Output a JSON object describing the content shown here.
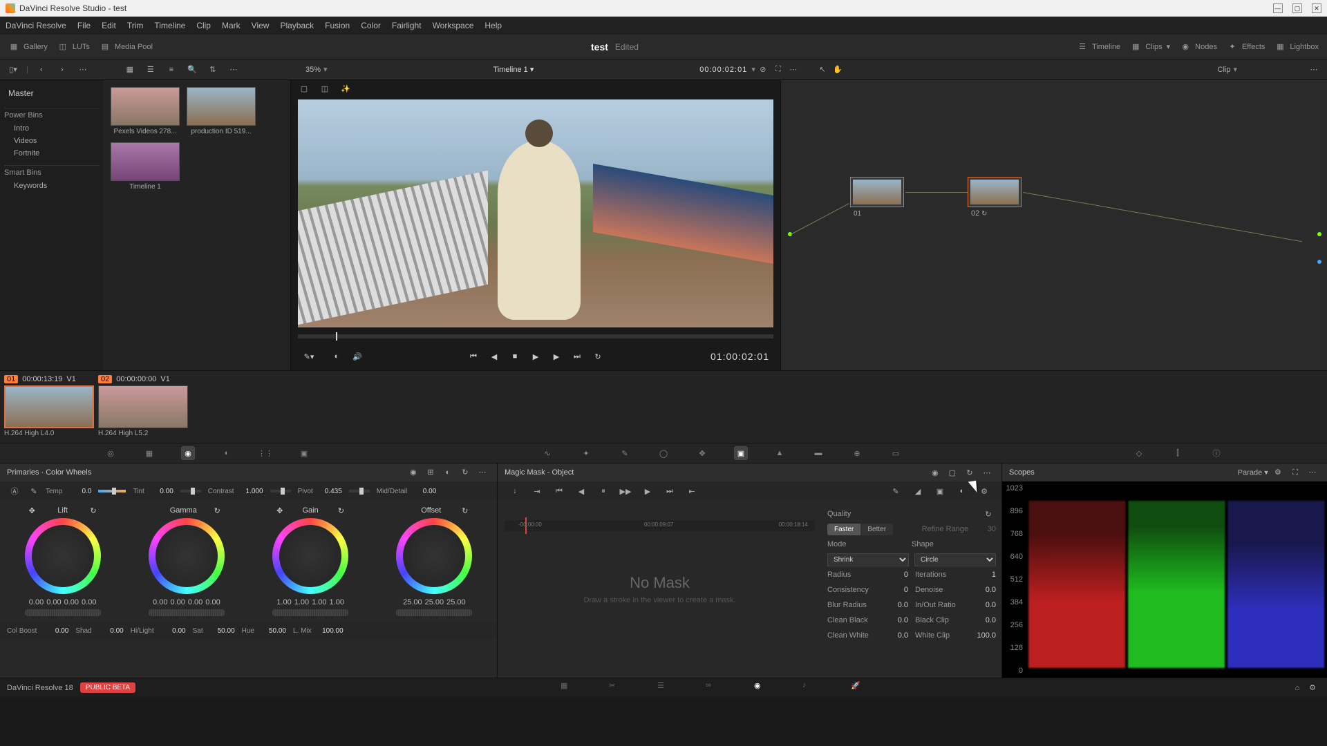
{
  "title": "DaVinci Resolve Studio - test",
  "menu": [
    "DaVinci Resolve",
    "File",
    "Edit",
    "Trim",
    "Timeline",
    "Clip",
    "Mark",
    "View",
    "Playback",
    "Fusion",
    "Color",
    "Fairlight",
    "Workspace",
    "Help"
  ],
  "toolbar": {
    "gallery": "Gallery",
    "luts": "LUTs",
    "mediapool": "Media Pool",
    "project": "test",
    "edited": "Edited",
    "timeline": "Timeline",
    "clips": "Clips",
    "nodes": "Nodes",
    "effects": "Effects",
    "lightbox": "Lightbox"
  },
  "subhdr": {
    "zoom": "35%",
    "timeline_name": "Timeline 1",
    "timecode": "00:00:02:01",
    "clip": "Clip"
  },
  "bins": {
    "master": "Master",
    "powerbins_label": "Power Bins",
    "powerbins": [
      "Intro",
      "Videos",
      "Fortnite"
    ],
    "smartbins_label": "Smart Bins",
    "smartbins": [
      "Keywords"
    ]
  },
  "clips": [
    {
      "name": "Pexels Videos 278..."
    },
    {
      "name": "production ID 519..."
    },
    {
      "name": "Timeline 1"
    }
  ],
  "viewer_tc": "01:00:02:01",
  "nodes": [
    {
      "label": "01"
    },
    {
      "label": "02"
    }
  ],
  "tlclips": [
    {
      "idx": "01",
      "tc": "00:00:13:19",
      "track": "V1",
      "codec": "H.264 High L4.0"
    },
    {
      "idx": "02",
      "tc": "00:00:00:00",
      "track": "V1",
      "codec": "H.264 High L5.2"
    }
  ],
  "primaries": {
    "title": "Primaries · Color Wheels",
    "adjustments": {
      "temp_lbl": "Temp",
      "temp": "0.0",
      "tint_lbl": "Tint",
      "tint": "0.00",
      "contrast_lbl": "Contrast",
      "contrast": "1.000",
      "pivot_lbl": "Pivot",
      "pivot": "0.435",
      "md_lbl": "Mid/Detail",
      "md": "0.00"
    },
    "wheels": [
      {
        "name": "Lift",
        "vals": [
          "0.00",
          "0.00",
          "0.00",
          "0.00"
        ]
      },
      {
        "name": "Gamma",
        "vals": [
          "0.00",
          "0.00",
          "0.00",
          "0.00"
        ]
      },
      {
        "name": "Gain",
        "vals": [
          "1.00",
          "1.00",
          "1.00",
          "1.00"
        ]
      },
      {
        "name": "Offset",
        "vals": [
          "25.00",
          "25.00",
          "25.00"
        ]
      }
    ],
    "bottom": {
      "colboost_lbl": "Col Boost",
      "colboost": "0.00",
      "shad_lbl": "Shad",
      "shad": "0.00",
      "hilight_lbl": "Hi/Light",
      "hilight": "0.00",
      "sat_lbl": "Sat",
      "sat": "50.00",
      "hue_lbl": "Hue",
      "hue": "50.00",
      "lmix_lbl": "L. Mix",
      "lmix": "100.00"
    }
  },
  "mask": {
    "title": "Magic Mask - Object",
    "nomask": "No Mask",
    "nomask_sub": "Draw a stroke in the viewer to create a mask.",
    "tl_marks": [
      "-00:00:00",
      "00:00:09:07",
      "00:00:18:14"
    ],
    "quality_lbl": "Quality",
    "faster": "Faster",
    "better": "Better",
    "refine_lbl": "Refine Range",
    "refine": "30",
    "mode_lbl": "Mode",
    "mode": "Shrink",
    "shape_lbl": "Shape",
    "shape": "Circle",
    "radius_lbl": "Radius",
    "radius": "0",
    "iter_lbl": "Iterations",
    "iter": "1",
    "cons_lbl": "Consistency",
    "cons": "0",
    "denoise_lbl": "Denoise",
    "denoise": "0.0",
    "blur_lbl": "Blur Radius",
    "blur": "0.0",
    "inout_lbl": "In/Out Ratio",
    "inout": "0.0",
    "cblack_lbl": "Clean Black",
    "cblack": "0.0",
    "bclip_lbl": "Black Clip",
    "bclip": "0.0",
    "cwhite_lbl": "Clean White",
    "cwhite": "0.0",
    "wclip_lbl": "White Clip",
    "wclip": "100.0"
  },
  "scopes": {
    "title": "Scopes",
    "mode": "Parade",
    "ticks": [
      "1023",
      "896",
      "768",
      "640",
      "512",
      "384",
      "256",
      "128",
      "0"
    ]
  },
  "status": {
    "app": "DaVinci Resolve 18",
    "beta": "PUBLIC BETA"
  }
}
